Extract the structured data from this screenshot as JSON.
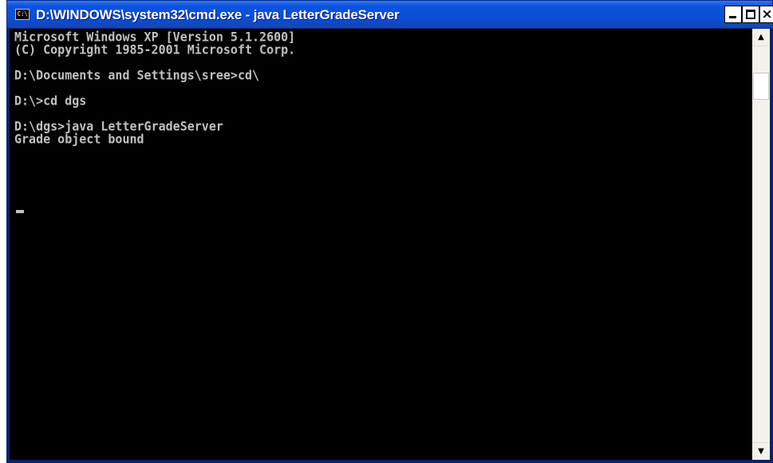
{
  "window": {
    "title": "D:\\WINDOWS\\system32\\cmd.exe - java LetterGradeServer",
    "icon_text": "C:\\",
    "icon": "console-icon",
    "controls": {
      "minimize": "minimize-icon",
      "maximize": "maximize-icon",
      "close_glyph": "×",
      "close": "close-icon"
    }
  },
  "console": {
    "lines": [
      "Microsoft Windows XP [Version 5.1.2600]",
      "(C) Copyright 1985-2001 Microsoft Corp.",
      "",
      "D:\\Documents and Settings\\sree>cd\\",
      "",
      "D:\\>cd dgs",
      "",
      "D:\\dgs>java LetterGradeServer",
      "Grade object bound"
    ]
  },
  "scrollbar": {
    "up_glyph": "▲",
    "down_glyph": "▼"
  },
  "colors": {
    "titlebar": "#0a4fd6",
    "console_bg": "#000000",
    "console_text": "#c0c0c0",
    "scrollbar_bg": "#f3f1ec"
  }
}
